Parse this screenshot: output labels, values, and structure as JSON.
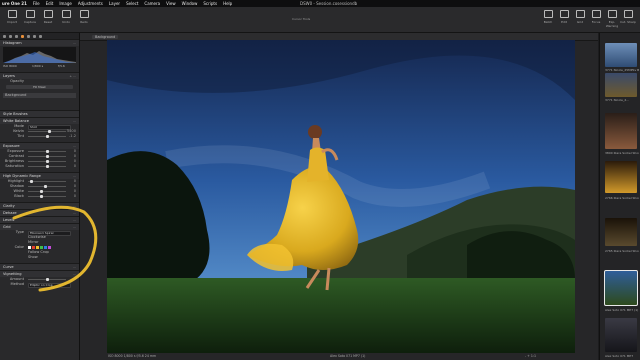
{
  "menubar": {
    "app": "ure One 21",
    "items": [
      "File",
      "Edit",
      "Image",
      "Adjustments",
      "Layer",
      "Select",
      "Camera",
      "View",
      "Window",
      "Scripts",
      "Help"
    ],
    "filename": "DSW0 - Session.cosessiondb"
  },
  "toolbar": {
    "left": [
      "Import",
      "Capture",
      "Reset",
      "Undo",
      "Redo"
    ],
    "center_label": "Cursor Tools",
    "right": [
      "Batch",
      "Edit",
      "Grid",
      "Focus",
      "Exp. Warning",
      "Cut. Sharp"
    ]
  },
  "left_panel": {
    "histogram_title": "Histogram",
    "histogram_info": [
      "ISO 8000",
      "1/800 s",
      "f/5.6"
    ],
    "layers_title": "Layers",
    "layers_opacity_label": "Opacity",
    "layers_button": "Fill Mask",
    "layer_name": "Background",
    "style_brushes": "Style Brushes",
    "white_balance": {
      "title": "White Balance",
      "mode_label": "Mode",
      "mode_value": "Shot",
      "rows": [
        {
          "label": "Kelvin",
          "value": "5400"
        },
        {
          "label": "Tint",
          "value": "-1.2"
        }
      ]
    },
    "exposure": {
      "title": "Exposure",
      "rows": [
        {
          "label": "Exposure",
          "value": "0"
        },
        {
          "label": "Contrast",
          "value": "0"
        },
        {
          "label": "Brightness",
          "value": "0"
        },
        {
          "label": "Saturation",
          "value": "0"
        }
      ]
    },
    "hdr": {
      "title": "High Dynamic Range",
      "rows": [
        {
          "label": "Highlight",
          "value": "0"
        },
        {
          "label": "Shadow",
          "value": "0"
        },
        {
          "label": "White",
          "value": "0"
        },
        {
          "label": "Black",
          "value": "0"
        }
      ]
    },
    "collapsed": [
      "Clarity",
      "Dehaze",
      "Levels"
    ],
    "grid": {
      "title": "Grid",
      "type_label": "Type",
      "type_value": "Fibonacci Spiral",
      "options": [
        "Clockwise",
        "Mirror"
      ],
      "color_label": "Color",
      "swatch_colors": [
        "#ffffff",
        "#e03b2d",
        "#f2c230",
        "#3fbf4a",
        "#2f7ee0",
        "#c44dd9"
      ],
      "checks": [
        "Follow Crop",
        "Show"
      ]
    },
    "curve": "Curve",
    "vignetting": {
      "title": "Vignetting",
      "amount_label": "Amount",
      "method_label": "Method",
      "method_value": "Elliptic on Crop"
    }
  },
  "viewer": {
    "layer_chip": "Background",
    "footer_left": [
      "ISO 8000",
      "1/800 s",
      "f/5.6",
      "24 mm"
    ],
    "footer_center": "Alex Soto 071 MP7 (1)",
    "footer_right": [
      "-",
      "+",
      "1:1"
    ]
  },
  "browser": {
    "items": [
      {
        "label": "3771 Nicole_25MPSv Blog",
        "color": "#3a5e8c"
      },
      {
        "label": "3771 Nicole_2...",
        "color": "#6e5a2c"
      },
      {
        "label": "3800 Klara Sorkel Shoot",
        "color": "#8a5a3c"
      },
      {
        "label": "2766 Klara Sorkel Shoot",
        "color": "#d29a2a"
      },
      {
        "label": "2765 Klara Sorkel Shoot",
        "color": "#5a4a2e"
      },
      {
        "label": "Alex Soto 071 MP7 (1)",
        "color": "#2f5e9a"
      },
      {
        "label": "Alex Soto 071 MP7",
        "color": "#3a3a44"
      }
    ]
  },
  "colors": {
    "accent": "#e8903a",
    "annotation": "#f2c230"
  }
}
